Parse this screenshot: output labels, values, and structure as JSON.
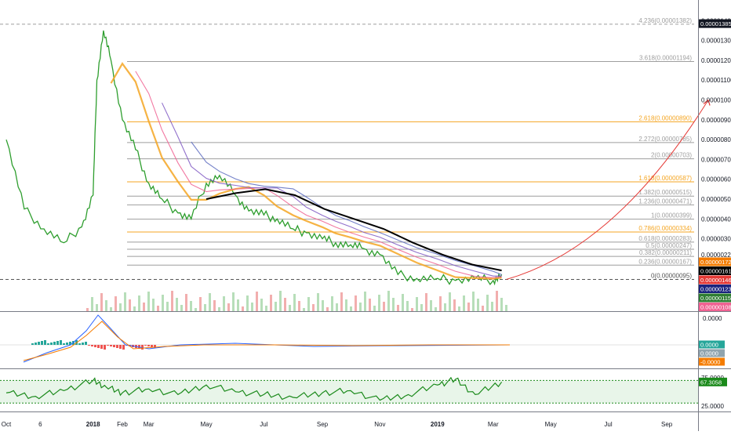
{
  "chart_data": [
    {
      "type": "line",
      "name": "price",
      "scale": "linear",
      "x_ticks": [
        "Oct",
        "6",
        "2018",
        "Feb",
        "Mar",
        "May",
        "Jul",
        "Sep",
        "Nov",
        "2019",
        "Mar",
        "May",
        "Jul",
        "Sep"
      ],
      "y_ticks": [
        "0.00001500",
        "0.00001400",
        "0.00001300",
        "0.00001200",
        "0.00001100",
        "0.00001000",
        "0.00000900",
        "0.00000800",
        "0.00000700",
        "0.00000600",
        "0.00000500",
        "0.00000400",
        "0.00000300",
        "0.00000220"
      ],
      "ylim": [
        5e-07,
        1.53e-05
      ],
      "x": [
        "2017-10-01",
        "2017-10-20",
        "2017-11-10",
        "2017-12-01",
        "2017-12-20",
        "2018-01-01",
        "2018-01-05",
        "2018-01-12",
        "2018-01-20",
        "2018-02-01",
        "2018-02-15",
        "2018-03-01",
        "2018-03-15",
        "2018-04-01",
        "2018-04-15",
        "2018-05-01",
        "2018-05-15",
        "2018-06-01",
        "2018-06-15",
        "2018-07-01",
        "2018-07-15",
        "2018-08-01",
        "2018-08-15",
        "2018-09-01",
        "2018-09-15",
        "2018-10-01",
        "2018-10-15",
        "2018-11-01",
        "2018-11-20",
        "2018-12-10",
        "2019-01-01",
        "2019-01-20",
        "2019-02-10",
        "2019-03-01",
        "2019-03-10"
      ],
      "close": [
        8e-06,
        4.5e-06,
        3.5e-06,
        2.8e-06,
        3.6e-06,
        5.2e-06,
        1.1e-05,
        1.35e-05,
        1.2e-05,
        9e-06,
        7.5e-06,
        5.8e-06,
        5e-06,
        4.3e-06,
        4e-06,
        5.8e-06,
        6.2e-06,
        5.2e-06,
        4.4e-06,
        4.2e-06,
        4e-06,
        3.5e-06,
        3.3e-06,
        3e-06,
        2.8e-06,
        2.7e-06,
        2.5e-06,
        2.2e-06,
        1.2e-06,
        1e-06,
        1e-06,
        9e-07,
        1e-06,
        9e-07,
        1.2e-06
      ],
      "moving_average_black": {
        "x_start": "2018-05-01",
        "x_end": "2019-03-10",
        "values": [
          5e-06,
          5.3e-06,
          5.5e-06,
          5.2e-06,
          4.5e-06,
          4e-06,
          3.5e-06,
          2.8e-06,
          2.2e-06,
          1.7e-06,
          1.4e-06
        ]
      },
      "fib_levels": [
        {
          "label": "4.236(0.00001382)",
          "value": 1.382e-05,
          "color": "#9e9e9e",
          "style": "dashed"
        },
        {
          "label": "3.618(0.00001194)",
          "value": 1.194e-05,
          "color": "#9e9e9e"
        },
        {
          "label": "2.618(0.00000890)",
          "value": 8.9e-06,
          "color": "#f5a623"
        },
        {
          "label": "2.272(0.00000785)",
          "value": 7.85e-06,
          "color": "#9e9e9e"
        },
        {
          "label": "2(0.00000703)",
          "value": 7.03e-06,
          "color": "#9e9e9e"
        },
        {
          "label": "1.618(0.00000587)",
          "value": 5.87e-06,
          "color": "#f5a623"
        },
        {
          "label": "1.382(0.00000515)",
          "value": 5.15e-06,
          "color": "#9e9e9e"
        },
        {
          "label": "1.236(0.00000471)",
          "value": 4.71e-06,
          "color": "#9e9e9e"
        },
        {
          "label": "1(0.00000399)",
          "value": 3.99e-06,
          "color": "#9e9e9e"
        },
        {
          "label": "0.786(0.00000334)",
          "value": 3.34e-06,
          "color": "#f5a623"
        },
        {
          "label": "0.618(0.00000283)",
          "value": 2.83e-06,
          "color": "#9e9e9e"
        },
        {
          "label": "0.5(0.00000247)",
          "value": 2.47e-06,
          "color": "#9e9e9e"
        },
        {
          "label": "0.382(0.00000211)",
          "value": 2.11e-06,
          "color": "#9e9e9e"
        },
        {
          "label": "0.236(0.00000167)",
          "value": 1.67e-06,
          "color": "#9e9e9e"
        },
        {
          "label": "0(0.00000095)",
          "value": 9.5e-07,
          "color": "#555555",
          "style": "dashed"
        }
      ],
      "price_badges": [
        {
          "label": "0.00001385",
          "value": 1.385e-05,
          "bg": "#131722",
          "fg": "#ffffff"
        },
        {
          "label": "0.00000172",
          "value": 1.72e-06,
          "bg": "#f57c00",
          "fg": "#ffffff"
        },
        {
          "label": "0.00000161",
          "value": 1.61e-06,
          "bg": "#000000",
          "fg": "#ffffff"
        },
        {
          "label": "0.00000146",
          "value": 1.46e-06,
          "bg": "#e53935",
          "fg": "#ffffff"
        },
        {
          "label": "0.00000123",
          "value": 1.23e-06,
          "bg": "#1a237e",
          "fg": "#ffffff"
        },
        {
          "label": "0.00000115",
          "value": 1.15e-06,
          "bg": "#2e7d32",
          "fg": "#ffffff"
        },
        {
          "label": "0.00000108",
          "value": 1.08e-06,
          "bg": "#f06292",
          "fg": "#ffffff"
        }
      ],
      "projection_arrow": {
        "from": [
          "2019-03-15",
          9.5e-07
        ],
        "to": [
          "2019-10-15",
          1e-05
        ],
        "color": "#e53935"
      }
    },
    {
      "type": "line",
      "name": "macd",
      "y_ticks": [
        "0.0000"
      ],
      "series_colors": [
        "#2962ff",
        "#f57c00"
      ],
      "value_badges": [
        {
          "label": "0.0000",
          "bg": "#26a69a"
        },
        {
          "label": "0.0000",
          "bg": "#90a4ae"
        },
        {
          "label": "-0.0000",
          "bg": "#f57c00"
        }
      ]
    },
    {
      "type": "line",
      "name": "rsi",
      "y_ticks": [
        "75.0000",
        "25.0000"
      ],
      "ylim": [
        15,
        90
      ],
      "bands": {
        "upper": 70,
        "lower": 30
      },
      "color": "#1b8a1b",
      "last_value_label": "67.3058",
      "x": [
        "2017-10-01",
        "2017-11-01",
        "2017-12-01",
        "2018-01-01",
        "2018-01-15",
        "2018-02-01",
        "2018-03-01",
        "2018-04-01",
        "2018-05-01",
        "2018-06-01",
        "2018-07-01",
        "2018-08-01",
        "2018-09-01",
        "2018-10-01",
        "2018-11-01",
        "2018-12-01",
        "2019-01-01",
        "2019-01-20",
        "2019-02-10",
        "2019-03-10"
      ],
      "values": [
        48,
        42,
        52,
        70,
        58,
        48,
        55,
        45,
        62,
        50,
        45,
        40,
        48,
        52,
        35,
        45,
        62,
        72,
        45,
        67.3058
      ]
    }
  ]
}
